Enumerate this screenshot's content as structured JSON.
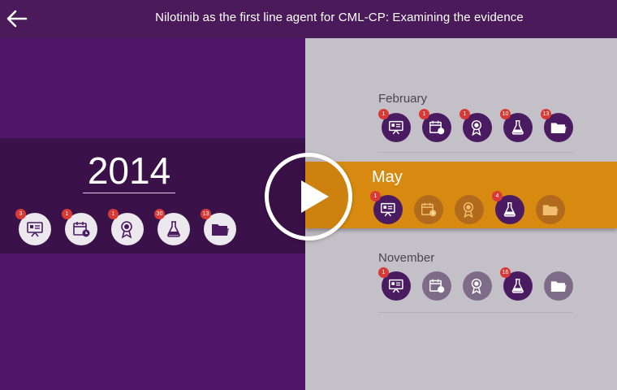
{
  "header": {
    "back_icon": "arrow-left-icon",
    "title": "Nilotinib as the first line agent for CML-CP: Examining the evidence"
  },
  "colors": {
    "header": "#4a1a5a",
    "left_panel": "#4f1669",
    "year_band": "#3b1149",
    "right_panel": "#c3c0c7",
    "active_month": "#d88a10",
    "badge": "#d93a35"
  },
  "year_panel": {
    "year": "2014",
    "icons": [
      {
        "name": "presentation-icon",
        "badge": "3"
      },
      {
        "name": "calendar-icon",
        "badge": "1"
      },
      {
        "name": "award-icon",
        "badge": "1"
      },
      {
        "name": "flask-icon",
        "badge": "30"
      },
      {
        "name": "folder-icon",
        "badge": "13"
      }
    ]
  },
  "months": [
    {
      "label": "February",
      "icons": [
        {
          "name": "presentation-icon",
          "badge": "1"
        },
        {
          "name": "calendar-icon",
          "badge": "1"
        },
        {
          "name": "award-icon",
          "badge": "1"
        },
        {
          "name": "flask-icon",
          "badge": "10"
        },
        {
          "name": "folder-icon",
          "badge": "13"
        }
      ]
    },
    {
      "label": "May",
      "active": true,
      "icons": [
        {
          "name": "presentation-icon",
          "badge": "1"
        },
        {
          "name": "calendar-icon",
          "badge": ""
        },
        {
          "name": "award-icon",
          "badge": ""
        },
        {
          "name": "flask-icon",
          "badge": "4"
        },
        {
          "name": "folder-icon",
          "badge": ""
        }
      ]
    },
    {
      "label": "November",
      "icons": [
        {
          "name": "presentation-icon",
          "badge": "1"
        },
        {
          "name": "calendar-icon",
          "badge": ""
        },
        {
          "name": "award-icon",
          "badge": ""
        },
        {
          "name": "flask-icon",
          "badge": "16"
        },
        {
          "name": "folder-icon",
          "badge": ""
        }
      ]
    }
  ],
  "play_button": {
    "icon": "play-icon"
  }
}
